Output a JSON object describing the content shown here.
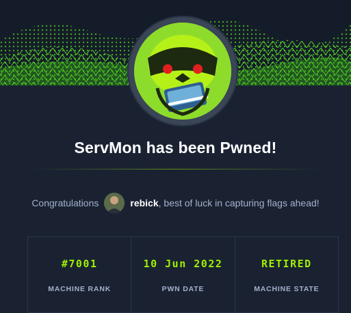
{
  "machine": {
    "title": "ServMon has been Pwned!"
  },
  "congrats": {
    "prefix": "Congratulations",
    "username": "rebick",
    "suffix": ", best of luck in capturing flags ahead!"
  },
  "stats": [
    {
      "value": "#7001",
      "label": "MACHINE RANK"
    },
    {
      "value": "10 Jun 2022",
      "label": "PWN DATE"
    },
    {
      "value": "RETIRED",
      "label": "MACHINE STATE"
    }
  ],
  "colors": {
    "accent": "#9fef00",
    "background": "#1a2232",
    "muted_text": "#a4b1cd"
  },
  "icons": {
    "machine_avatar": "green-skull-icon",
    "user_avatar": "user-avatar"
  }
}
